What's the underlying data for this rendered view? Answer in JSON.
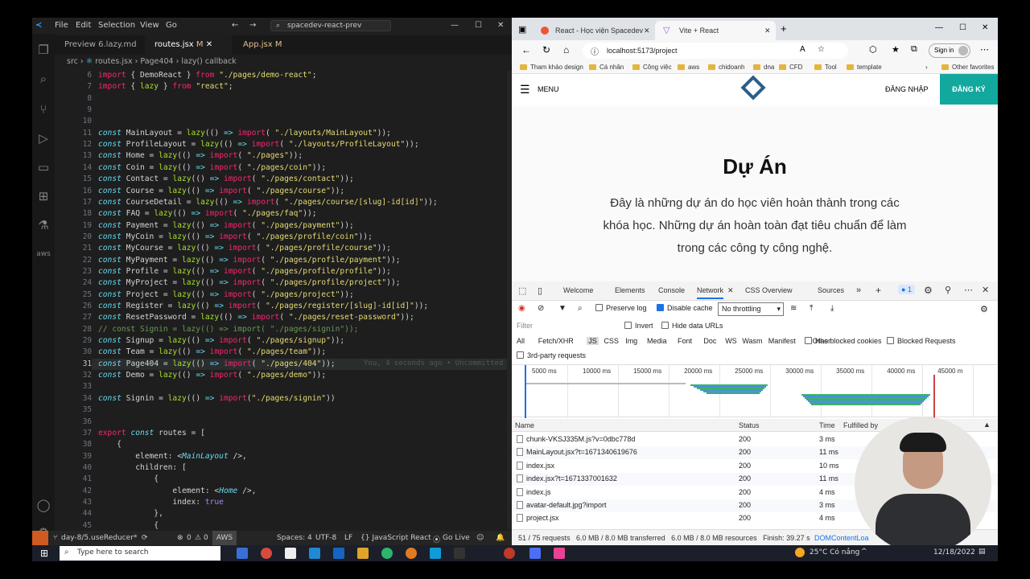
{
  "vscode": {
    "menu": [
      "File",
      "Edit",
      "Selection",
      "View",
      "Go"
    ],
    "search": "spacedev-react-prev",
    "tabs": [
      {
        "label": "Preview 6.lazy.md"
      },
      {
        "label": "routes.jsx",
        "mod": "M"
      },
      {
        "label": "App.jsx",
        "mod": "M"
      }
    ],
    "breadcrumb": {
      "src": "src",
      "file": "routes.jsx",
      "comp": "Page404",
      "fn": "lazy() callback"
    },
    "blame": "You, 4 seconds ago • Uncommitted",
    "status": {
      "branch": "day-8/5.useReducer*",
      "errors": "0",
      "warnings": "0",
      "aws": "AWS",
      "spaces": "Spaces: 4",
      "enc": "UTF-8",
      "eol": "LF",
      "lang": "{} JavaScript React",
      "live": "Go Live"
    }
  },
  "code": [
    {
      "n": "6",
      "t": "import { DemoReact } from \"./pages/demo-react\";"
    },
    {
      "n": "7",
      "t": "import { lazy } from \"react\";"
    },
    {
      "n": "8",
      "t": ""
    },
    {
      "n": "9",
      "t": ""
    },
    {
      "n": "10",
      "t": ""
    },
    {
      "n": "11",
      "t": "const MainLayout = lazy(() => import( \"./layouts/MainLayout\"));"
    },
    {
      "n": "12",
      "t": "const ProfileLayout = lazy(() => import( \"./layouts/ProfileLayout\"));"
    },
    {
      "n": "13",
      "t": "const Home = lazy(() => import( \"./pages\"));"
    },
    {
      "n": "14",
      "t": "const Coin = lazy(() => import( \"./pages/coin\"));"
    },
    {
      "n": "15",
      "t": "const Contact = lazy(() => import( \"./pages/contact\"));"
    },
    {
      "n": "16",
      "t": "const Course = lazy(() => import( \"./pages/course\"));"
    },
    {
      "n": "17",
      "t": "const CourseDetail = lazy(() => import( \"./pages/course/[slug]-id[id]\"));"
    },
    {
      "n": "18",
      "t": "const FAQ = lazy(() => import( \"./pages/faq\"));"
    },
    {
      "n": "19",
      "t": "const Payment = lazy(() => import( \"./pages/payment\"));"
    },
    {
      "n": "20",
      "t": "const MyCoin = lazy(() => import( \"./pages/profile/coin\"));"
    },
    {
      "n": "21",
      "t": "const MyCourse = lazy(() => import( \"./pages/profile/course\"));"
    },
    {
      "n": "22",
      "t": "const MyPayment = lazy(() => import( \"./pages/profile/payment\"));"
    },
    {
      "n": "23",
      "t": "const Profile = lazy(() => import( \"./pages/profile/profile\"));"
    },
    {
      "n": "24",
      "t": "const MyProject = lazy(() => import( \"./pages/profile/project\"));"
    },
    {
      "n": "25",
      "t": "const Project = lazy(() => import( \"./pages/project\"));"
    },
    {
      "n": "26",
      "t": "const Register = lazy(() => import( \"./pages/register/[slug]-id[id]\"));"
    },
    {
      "n": "27",
      "t": "const ResetPassword = lazy(() => import( \"./pages/reset-password\"));"
    },
    {
      "n": "28",
      "t": "// const Signin = lazy(() => import( \"./pages/signin\"));"
    },
    {
      "n": "29",
      "t": "const Signup = lazy(() => import( \"./pages/signup\"));"
    },
    {
      "n": "30",
      "t": "const Team = lazy(() => import( \"./pages/team\"));"
    },
    {
      "n": "31",
      "t": "const Page404 = lazy(() => import( \"./pages/404\"));"
    },
    {
      "n": "32",
      "t": "const Demo = lazy(() => import( \"./pages/demo\"));"
    },
    {
      "n": "33",
      "t": ""
    },
    {
      "n": "34",
      "t": "const Signin = lazy(() => import(\"./pages/signin\"))"
    },
    {
      "n": "35",
      "t": ""
    },
    {
      "n": "36",
      "t": ""
    },
    {
      "n": "37",
      "t": "export const routes = ["
    },
    {
      "n": "38",
      "t": "    {"
    },
    {
      "n": "39",
      "t": "        element: <MainLayout />,"
    },
    {
      "n": "40",
      "t": "        children: ["
    },
    {
      "n": "41",
      "t": "            {"
    },
    {
      "n": "42",
      "t": "                element: <Home />,"
    },
    {
      "n": "43",
      "t": "                index: true"
    },
    {
      "n": "44",
      "t": "            },"
    },
    {
      "n": "45",
      "t": "            {"
    }
  ],
  "browser": {
    "tabs": [
      "React - Học viện Spacedev",
      "Vite + React"
    ],
    "url": "localhost:5173/project",
    "signin": "Sign in",
    "bookmarks": [
      "Tham khảo design",
      "Cá nhân",
      "Công việc",
      "aws",
      "chidoanh",
      "dna",
      "CFD",
      "Tool",
      "template"
    ],
    "other_fav": "Other favorites",
    "site": {
      "menu": "MENU",
      "login": "ĐĂNG NHẬP",
      "register": "ĐĂNG KÝ",
      "heading": "Dự Án",
      "desc1": "Đây là những dự án do học viên hoàn thành trong các",
      "desc2": "khóa học. Những dự án hoàn toàn đạt tiêu chuẩn để làm",
      "desc3": "trong các công ty công nghệ."
    }
  },
  "devtools": {
    "tabs": [
      "Welcome",
      "Elements",
      "Console",
      "Network",
      "CSS Overview",
      "Sources"
    ],
    "badge": "1",
    "preserve": "Preserve log",
    "disable": "Disable cache",
    "throttle": "No throttling",
    "filter": "Filter",
    "invert": "Invert",
    "hide": "Hide data URLs",
    "types": [
      "All",
      "Fetch/XHR",
      "JS",
      "CSS",
      "Img",
      "Media",
      "Font",
      "Doc",
      "WS",
      "Wasm",
      "Manifest",
      "Other"
    ],
    "blocked_cookies": "Has blocked cookies",
    "blocked_req": "Blocked Requests",
    "third": "3rd-party requests",
    "ticks": [
      "5000 ms",
      "10000 ms",
      "15000 ms",
      "20000 ms",
      "25000 ms",
      "30000 ms",
      "35000 ms",
      "40000 ms",
      "45000 m"
    ],
    "cols": [
      "Name",
      "Status",
      "Time",
      "Fulfilled by"
    ],
    "rows": [
      {
        "name": "chunk-VKSJ335M.js?v=0dbc778d",
        "status": "200",
        "time": "3 ms"
      },
      {
        "name": "MainLayout.jsx?t=1671340619676",
        "status": "200",
        "time": "11 ms"
      },
      {
        "name": "index.jsx",
        "status": "200",
        "time": "10 ms"
      },
      {
        "name": "index.jsx?t=1671337001632",
        "status": "200",
        "time": "11 ms"
      },
      {
        "name": "index.js",
        "status": "200",
        "time": "4 ms"
      },
      {
        "name": "avatar-default.jpg?import",
        "status": "200",
        "time": "3 ms"
      },
      {
        "name": "project.jsx",
        "status": "200",
        "time": "4 ms"
      }
    ],
    "summary": "51 / 75 requests   6.0 MB / 8.0 MB transferred   6.0 MB / 8.0 MB resources   Finish: 39.27 s",
    "dcl": "DOMContentLoa"
  },
  "taskbar": {
    "search": "Type here to search",
    "weather": "25°C Có nắng",
    "date": "12/18/2022"
  }
}
